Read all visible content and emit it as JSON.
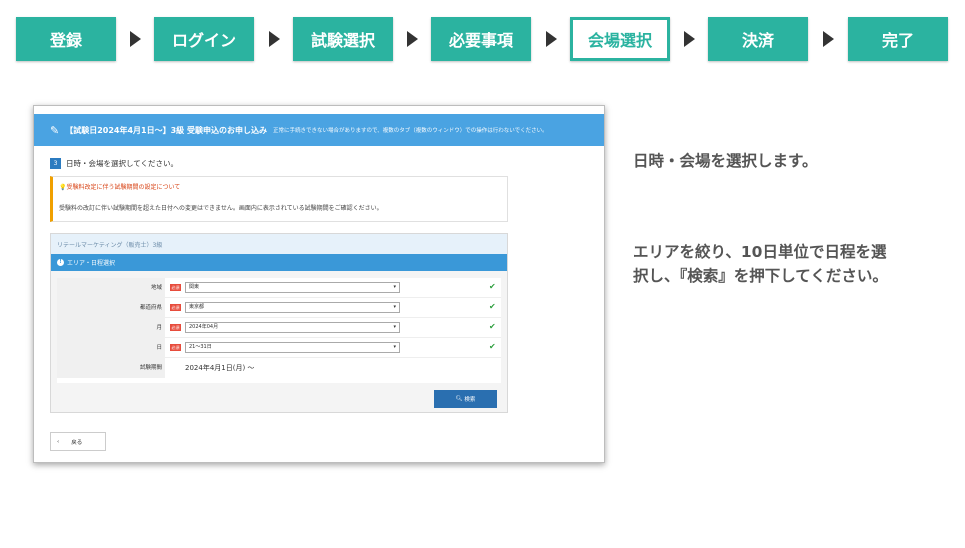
{
  "steps": [
    "登録",
    "ログイン",
    "試験選択",
    "必要事項",
    "会場選択",
    "決済",
    "完了"
  ],
  "current_step": "会場選択",
  "screenshot": {
    "header_title": "【試験日2024年4月1日〜】3級 受験申込のお申し込み",
    "header_note": "正常に手続きできない場合がありますので、複数のタブ（複数のウィンドウ）での操作は行わないでください。",
    "section_number": "3",
    "section_text": "日時・会場を選択してください。",
    "notice_title": "受験料改定に伴う試験期間の設定について",
    "notice_body": "受験料の改訂に伴い試験期間を超えた日付への変更はできません。画面内に表示されている試験期間をご確認ください。",
    "exam_name": "リテールマーケティング（販売士）3級",
    "area_bar": "エリア・日程選択",
    "required_label": "必須",
    "fields": [
      {
        "label": "地域",
        "value": "関東"
      },
      {
        "label": "都道府県",
        "value": "東京都"
      },
      {
        "label": "月",
        "value": "2024年04月"
      },
      {
        "label": "日",
        "value": "21〜31日"
      }
    ],
    "period_label": "試験期間",
    "period_value": "2024年4月1日(月) 〜",
    "search_button": "検索",
    "back_button": "戻る"
  },
  "instruction1": "日時・会場を選択します。",
  "instruction2_line1": "エリアを絞り、10日単位で日程を選",
  "instruction2_line2": "択し、『検索』を押下してください。",
  "colors": {
    "step": "#2bb3a0",
    "header": "#4aa3e2",
    "search_button": "#2a6fb0"
  }
}
